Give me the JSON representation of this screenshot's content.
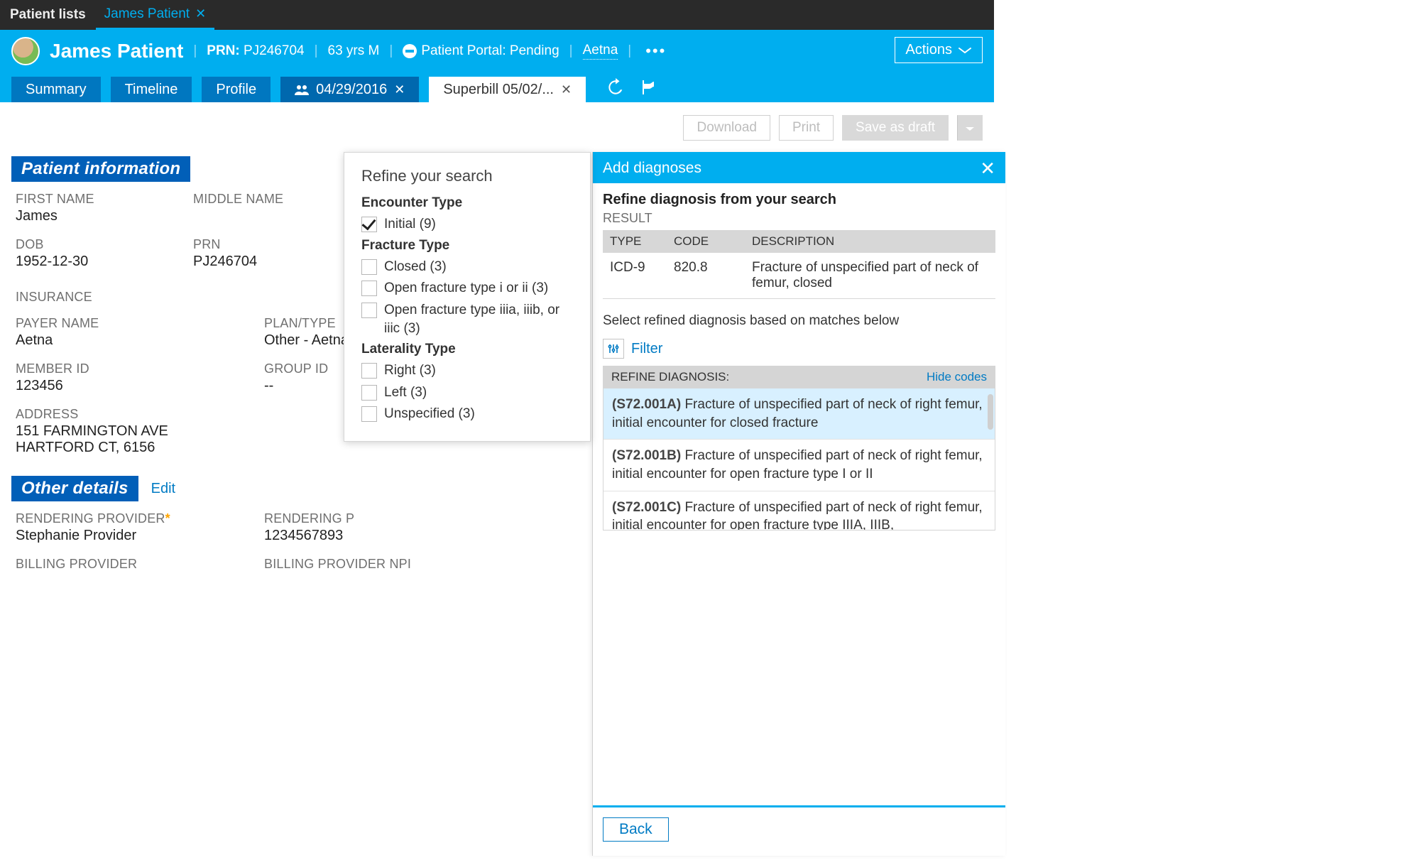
{
  "topbar": {
    "patient_lists": "Patient lists",
    "open_tab": "James Patient"
  },
  "header": {
    "patient_name": "James Patient",
    "prn_label": "PRN:",
    "prn": "PJ246704",
    "age_sex": "63 yrs M",
    "portal_label": "Patient Portal: Pending",
    "insurance_link": "Aetna",
    "actions_label": "Actions"
  },
  "subtabs": {
    "summary": "Summary",
    "timeline": "Timeline",
    "profile": "Profile",
    "date_tab": "04/29/2016",
    "superbill_tab": "Superbill 05/02/..."
  },
  "action_row": {
    "download": "Download",
    "print": "Print",
    "save_draft": "Save as draft"
  },
  "sections": {
    "patient_info_title": "Patient information",
    "other_details_title": "Other details",
    "edit": "Edit"
  },
  "patient_info": {
    "first_name_label": "FIRST NAME",
    "first_name": "James",
    "middle_name_label": "MIDDLE NAME",
    "dob_label": "DOB",
    "dob": "1952-12-30",
    "prn_label": "PRN",
    "prn": "PJ246704",
    "insurance_label": "INSURANCE",
    "payer_name_label": "PAYER NAME",
    "payer_name": "Aetna",
    "plan_type_label": "PLAN/TYPE",
    "plan_type": "Other - Aetna",
    "member_id_label": "MEMBER ID",
    "member_id": "123456",
    "group_id_label": "GROUP ID",
    "group_id": "--",
    "address_label": "ADDRESS",
    "address_line1": "151 FARMINGTON AVE",
    "address_line2": "HARTFORD CT, 6156"
  },
  "other_details": {
    "rendering_provider_label": "RENDERING PROVIDER",
    "rendering_provider": "Stephanie Provider",
    "rendering_provider_npi_label_partial": "RENDERING P",
    "rendering_provider_npi": "1234567893",
    "billing_provider_label": "BILLING PROVIDER",
    "billing_provider_npi_label": "BILLING PROVIDER NPI"
  },
  "refine_search": {
    "title": "Refine your search",
    "encounter_type_title": "Encounter Type",
    "encounter_initial": "Initial (9)",
    "fracture_type_title": "Fracture Type",
    "fracture_closed": "Closed (3)",
    "fracture_open_i_ii": "Open fracture type i or ii (3)",
    "fracture_open_iii": "Open fracture type iiia, iiib, or iiic (3)",
    "laterality_title": "Laterality Type",
    "laterality_right": "Right (3)",
    "laterality_left": "Left (3)",
    "laterality_unspecified": "Unspecified (3)"
  },
  "diagnoses_panel": {
    "title": "Add diagnoses",
    "subtitle": "Refine diagnosis from your search",
    "result_label": "RESULT",
    "table_headers": {
      "type": "TYPE",
      "code": "CODE",
      "description": "DESCRIPTION"
    },
    "result_row": {
      "type": "ICD-9",
      "code": "820.8",
      "description": "Fracture of unspecified part of neck of femur, closed"
    },
    "select_text": "Select refined diagnosis based on matches below",
    "filter_label": "Filter",
    "refine_dx_label": "REFINE DIAGNOSIS:",
    "hide_codes": "Hide codes",
    "items": [
      {
        "code": "(S72.001A)",
        "text": " Fracture of unspecified part of neck of right femur, initial encounter for closed fracture"
      },
      {
        "code": "(S72.001B)",
        "text": " Fracture of unspecified part of neck of right femur, initial encounter for open fracture type I or II"
      },
      {
        "code": "(S72.001C)",
        "text": " Fracture of unspecified part of neck of right femur, initial encounter for open fracture type IIIA, IIIB,"
      }
    ],
    "back": "Back"
  }
}
